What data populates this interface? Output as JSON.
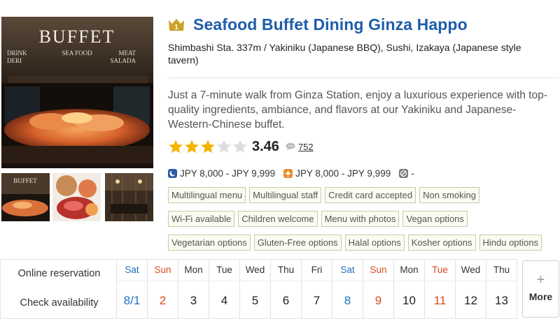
{
  "restaurant": {
    "rank": "1",
    "name": "Seafood Buffet Dining Ginza Happo",
    "subtitle": "Shimbashi Sta. 337m / Yakiniku (Japanese BBQ), Sushi, Izakaya (Japanese style tavern)",
    "description": "Just a 7-minute walk from Ginza Station, enjoy a luxurious experience with top-quality ingredients, ambiance, and flavors at our Yakiniku and Japanese-Western-Chinese buffet.",
    "rating": "3.46",
    "rating_stars": 3.46,
    "review_count": "752"
  },
  "photo_sign": {
    "main": "BUFFET",
    "left_top": "DRINK",
    "left_bottom": "DERI",
    "center": "SEA FOOD",
    "right_top": "MEAT",
    "right_bottom": "SALADA"
  },
  "thumb_sign": "BUFFET",
  "prices": {
    "dinner": "JPY 8,000 - JPY 9,999",
    "lunch": "JPY 8,000 - JPY 9,999",
    "other": "-"
  },
  "tags": [
    [
      "Multilingual menu",
      "Multilingual staff",
      "Credit card accepted",
      "Non smoking"
    ],
    [
      "Wi-Fi available",
      "Children welcome",
      "Menu with photos",
      "Vegan options"
    ],
    [
      "Vegetarian options",
      "Gluten-Free options",
      "Halal options",
      "Kosher options",
      "Hindu options"
    ]
  ],
  "availability": {
    "label_reservation": "Online reservation",
    "label_check": "Check availability",
    "more_label": "More",
    "days": [
      {
        "dow": "Sat",
        "date": "8/1",
        "type": "sat"
      },
      {
        "dow": "Sun",
        "date": "2",
        "type": "sun"
      },
      {
        "dow": "Mon",
        "date": "3",
        "type": "week"
      },
      {
        "dow": "Tue",
        "date": "4",
        "type": "week"
      },
      {
        "dow": "Wed",
        "date": "5",
        "type": "week"
      },
      {
        "dow": "Thu",
        "date": "6",
        "type": "week"
      },
      {
        "dow": "Fri",
        "date": "7",
        "type": "week"
      },
      {
        "dow": "Sat",
        "date": "8",
        "type": "sat"
      },
      {
        "dow": "Sun",
        "date": "9",
        "type": "sun"
      },
      {
        "dow": "Mon",
        "date": "10",
        "type": "week"
      },
      {
        "dow": "Tue",
        "date": "11",
        "type": "holiday"
      },
      {
        "dow": "Wed",
        "date": "12",
        "type": "week"
      },
      {
        "dow": "Thu",
        "date": "13",
        "type": "week"
      }
    ]
  },
  "colors": {
    "title": "#1e5dab",
    "star": "#f5b301",
    "sat": "#1e6fc4",
    "sun": "#d94a1e",
    "tag_border": "#c9c9a8",
    "rank_badge": "#c9a227"
  },
  "icons": {
    "dinner": "moon-icon",
    "lunch": "sun-icon",
    "other": "clock-icon",
    "reviews": "speech-bubble-icon",
    "more": "plus-icon"
  }
}
